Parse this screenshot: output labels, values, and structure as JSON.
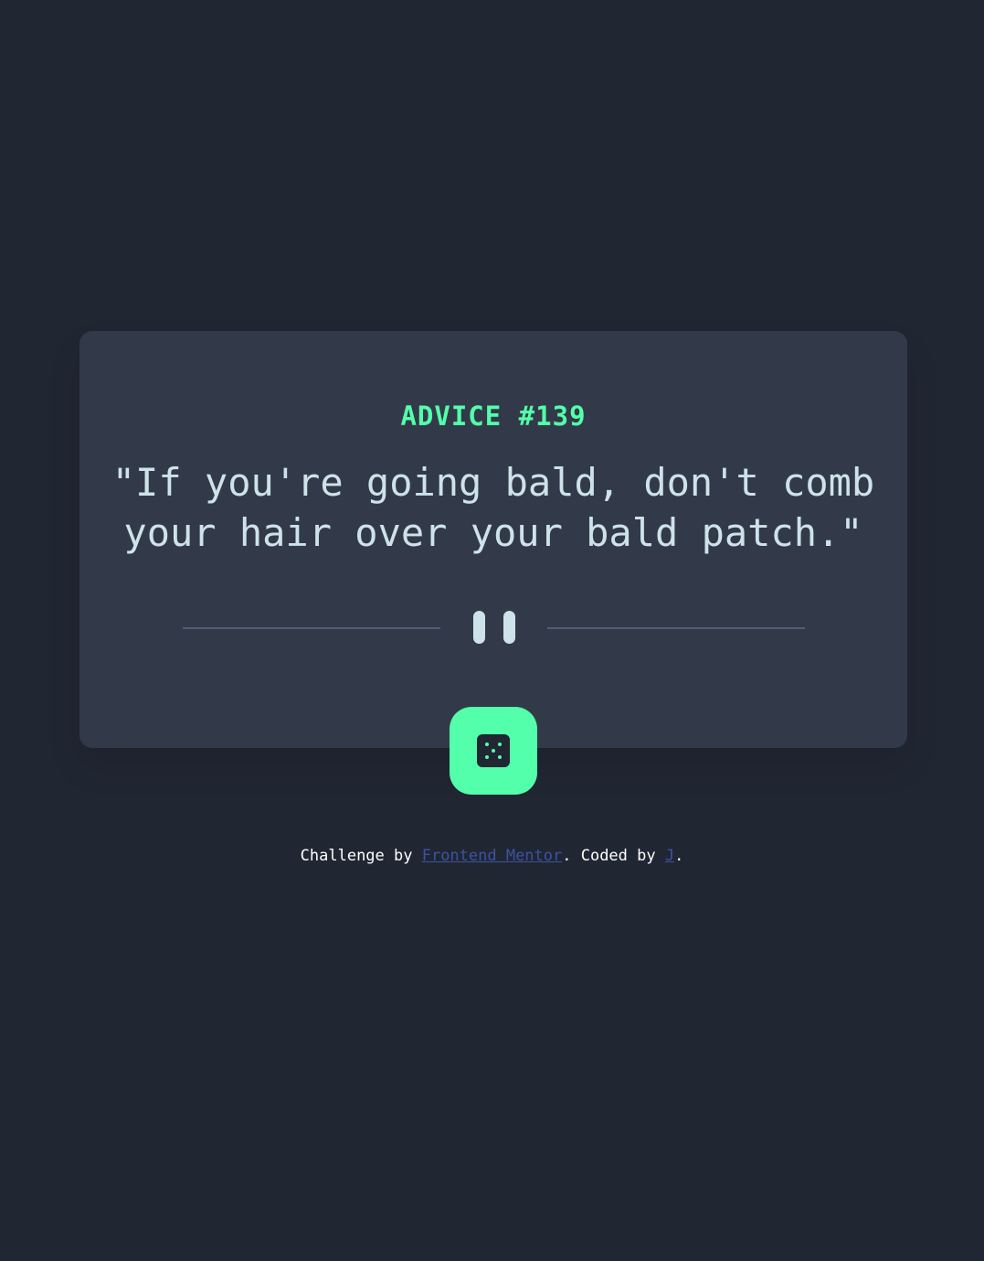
{
  "card": {
    "advice_id": "ADVICE #139",
    "advice_lines": [
      "\"If you're going bald, don't comb",
      "your hair over your bald patch.\""
    ]
  },
  "divider": {
    "icon": "pause-icon"
  },
  "dice_button": {
    "icon": "dice-icon",
    "aria_label": "Generate new advice"
  },
  "footer": {
    "challenge_prefix": "Challenge by ",
    "challenge_link": "Frontend Mentor",
    "coded_prefix": ". Coded by ",
    "author_link": "J",
    "suffix": "."
  },
  "colors": {
    "background": "#202632",
    "card": "#323a49",
    "accent": "#53ffaa",
    "text": "#cee3e9",
    "divider": "#4f5d74",
    "link": "#3e52a3"
  }
}
